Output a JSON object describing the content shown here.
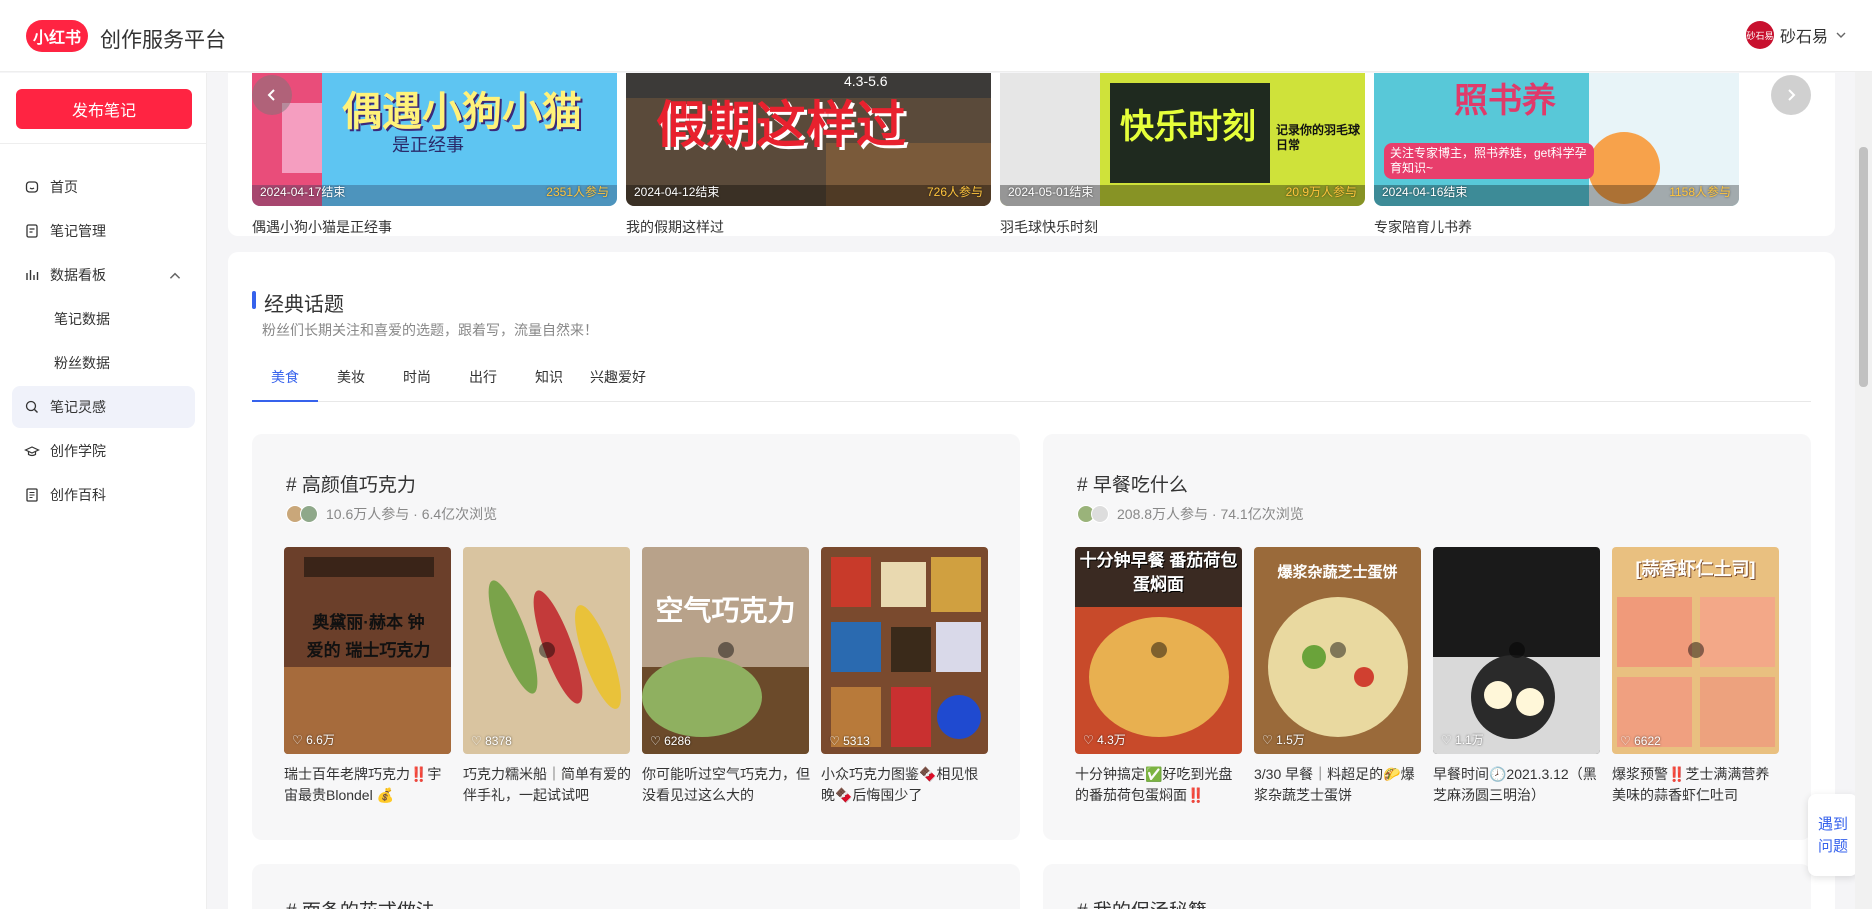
{
  "header": {
    "logo_text": "小红书",
    "app_title": "创作服务平台",
    "user_name": "砂石易",
    "avatar_text": "砂石易"
  },
  "sidebar": {
    "publish_label": "发布笔记",
    "items": [
      {
        "label": "首页",
        "icon": "home-icon"
      },
      {
        "label": "笔记管理",
        "icon": "note-icon"
      },
      {
        "label": "数据看板",
        "icon": "chart-icon"
      },
      {
        "label": "笔记数据",
        "icon": ""
      },
      {
        "label": "粉丝数据",
        "icon": ""
      },
      {
        "label": "笔记灵感",
        "icon": "inspiration-icon"
      },
      {
        "label": "创作学院",
        "icon": "academy-icon"
      },
      {
        "label": "创作百科",
        "icon": "wiki-icon"
      }
    ]
  },
  "carousel": {
    "cards": [
      {
        "date": "2024-04-17结束",
        "participants": "2351人参与",
        "title": "偶遇小狗小猫是正经事",
        "banner_text": "偶遇小狗小猫",
        "banner_sub": "是正经事"
      },
      {
        "date": "2024-04-12结束",
        "participants": "726人参与",
        "title": "我的假期这样过",
        "banner_text": "假期这样过",
        "banner_sub": "4.3-5.6"
      },
      {
        "date": "2024-05-01结束",
        "participants": "20.9万人参与",
        "title": "羽毛球快乐时刻",
        "banner_text": "快乐时刻",
        "banner_sub": "记录你的羽毛球日常"
      },
      {
        "date": "2024-04-16结束",
        "participants": "1158人参与",
        "title": "专家陪育儿书养",
        "banner_text": "照书养",
        "banner_sub": "关注专家博主，照书养娃，get科学孕育知识~"
      }
    ]
  },
  "section": {
    "title": "经典话题",
    "subtitle": "粉丝们长期关注和喜爱的选题，跟着写，流量自然来！",
    "tabs": [
      "美食",
      "美妆",
      "时尚",
      "出行",
      "知识",
      "兴趣爱好"
    ],
    "active_tab": "美食"
  },
  "topics": [
    {
      "title": "# 高颜值巧克力",
      "meta": "10.6万人参与 · 6.4亿次浏览",
      "notes": [
        {
          "likes": "6.6万",
          "caption": "瑞士百年老牌巧克力‼️宇宙最贵Blondel 💰",
          "overlay": "奥黛丽·赫本 钟爱的 瑞士巧克力"
        },
        {
          "likes": "8378",
          "caption": "巧克力糯米船｜简单有爱的伴手礼，一起试试吧",
          "overlay": ""
        },
        {
          "likes": "6286",
          "caption": "你可能听过空气巧克力，但没看见过这么大的",
          "overlay": "空气巧克力"
        },
        {
          "likes": "5313",
          "caption": "小众巧克力图鉴🍫相见恨晚🍫后悔囤少了",
          "overlay": ""
        }
      ]
    },
    {
      "title": "# 早餐吃什么",
      "meta": "208.8万人参与 · 74.1亿次浏览",
      "notes": [
        {
          "likes": "4.3万",
          "caption": "十分钟搞定✅好吃到光盘的番茄荷包蛋焖面‼️",
          "overlay": "十分钟早餐 番茄荷包蛋焖面"
        },
        {
          "likes": "1.5万",
          "caption": "3/30 早餐｜料超足的🌮爆浆杂蔬芝士蛋饼",
          "overlay": "爆浆杂蔬芝士蛋饼"
        },
        {
          "likes": "1.1万",
          "caption": "早餐时间🕗2021.3.12（黑芝麻汤圆三明治）",
          "overlay": ""
        },
        {
          "likes": "6622",
          "caption": "爆浆预警‼️芝士满满营养美味的蒜香虾仁吐司",
          "overlay": "[蒜香虾仁土司]"
        }
      ]
    }
  ],
  "next_topics": [
    "# 面条的花式做法",
    "# 我的保汤秘籍"
  ],
  "help": {
    "line1": "遇到",
    "line2": "问题"
  },
  "colors": {
    "brand": "#ff2442",
    "accent": "#3662ec"
  }
}
